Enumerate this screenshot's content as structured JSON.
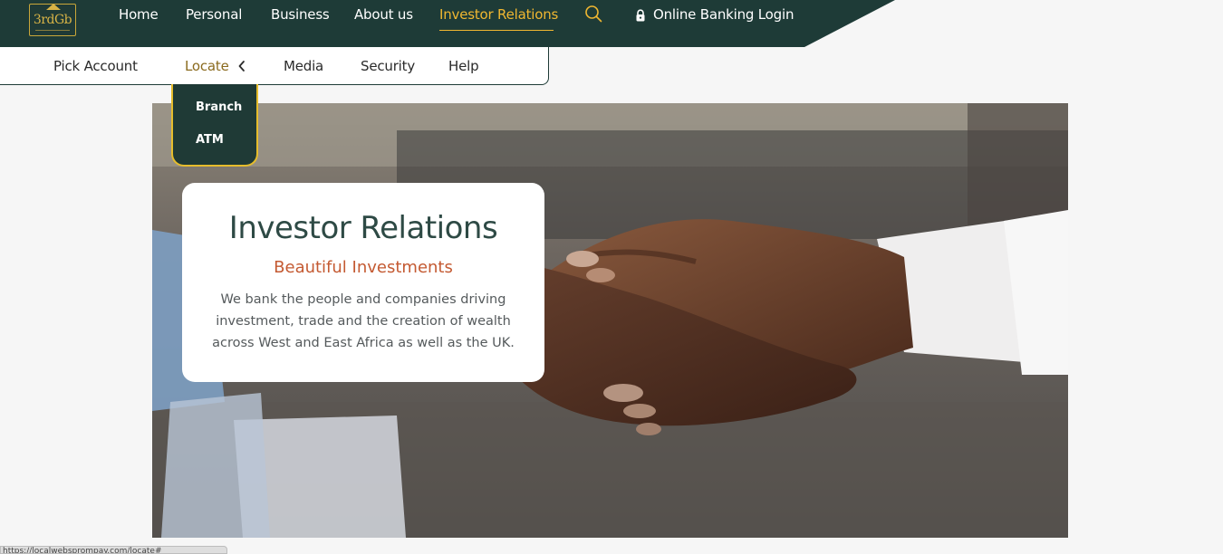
{
  "brand": {
    "logo_text": "3rdGb",
    "colors": {
      "dark": "#1e3b37",
      "accent": "#f0b731",
      "subtitle": "#c45a32"
    }
  },
  "nav": {
    "home": "Home",
    "personal": "Personal",
    "business": "Business",
    "about": "About us",
    "investor": "Investor Relations",
    "search_icon": "search-icon",
    "login": "Online Banking Login",
    "login_icon": "lock-icon"
  },
  "subnav": {
    "pick_account": "Pick Account",
    "locate": "Locate",
    "media": "Media",
    "security": "Security",
    "help": "Help"
  },
  "dropdown": {
    "items": [
      "Branch",
      "ATM"
    ]
  },
  "hero_card": {
    "title": "Investor Relations",
    "subtitle": "Beautiful Investments",
    "body": "We bank the people and companies driving investment, trade and the creation of wealth across West and East Africa as well as the UK."
  },
  "status_bar": {
    "url": "https://localwebsprompay.com/locate#"
  }
}
